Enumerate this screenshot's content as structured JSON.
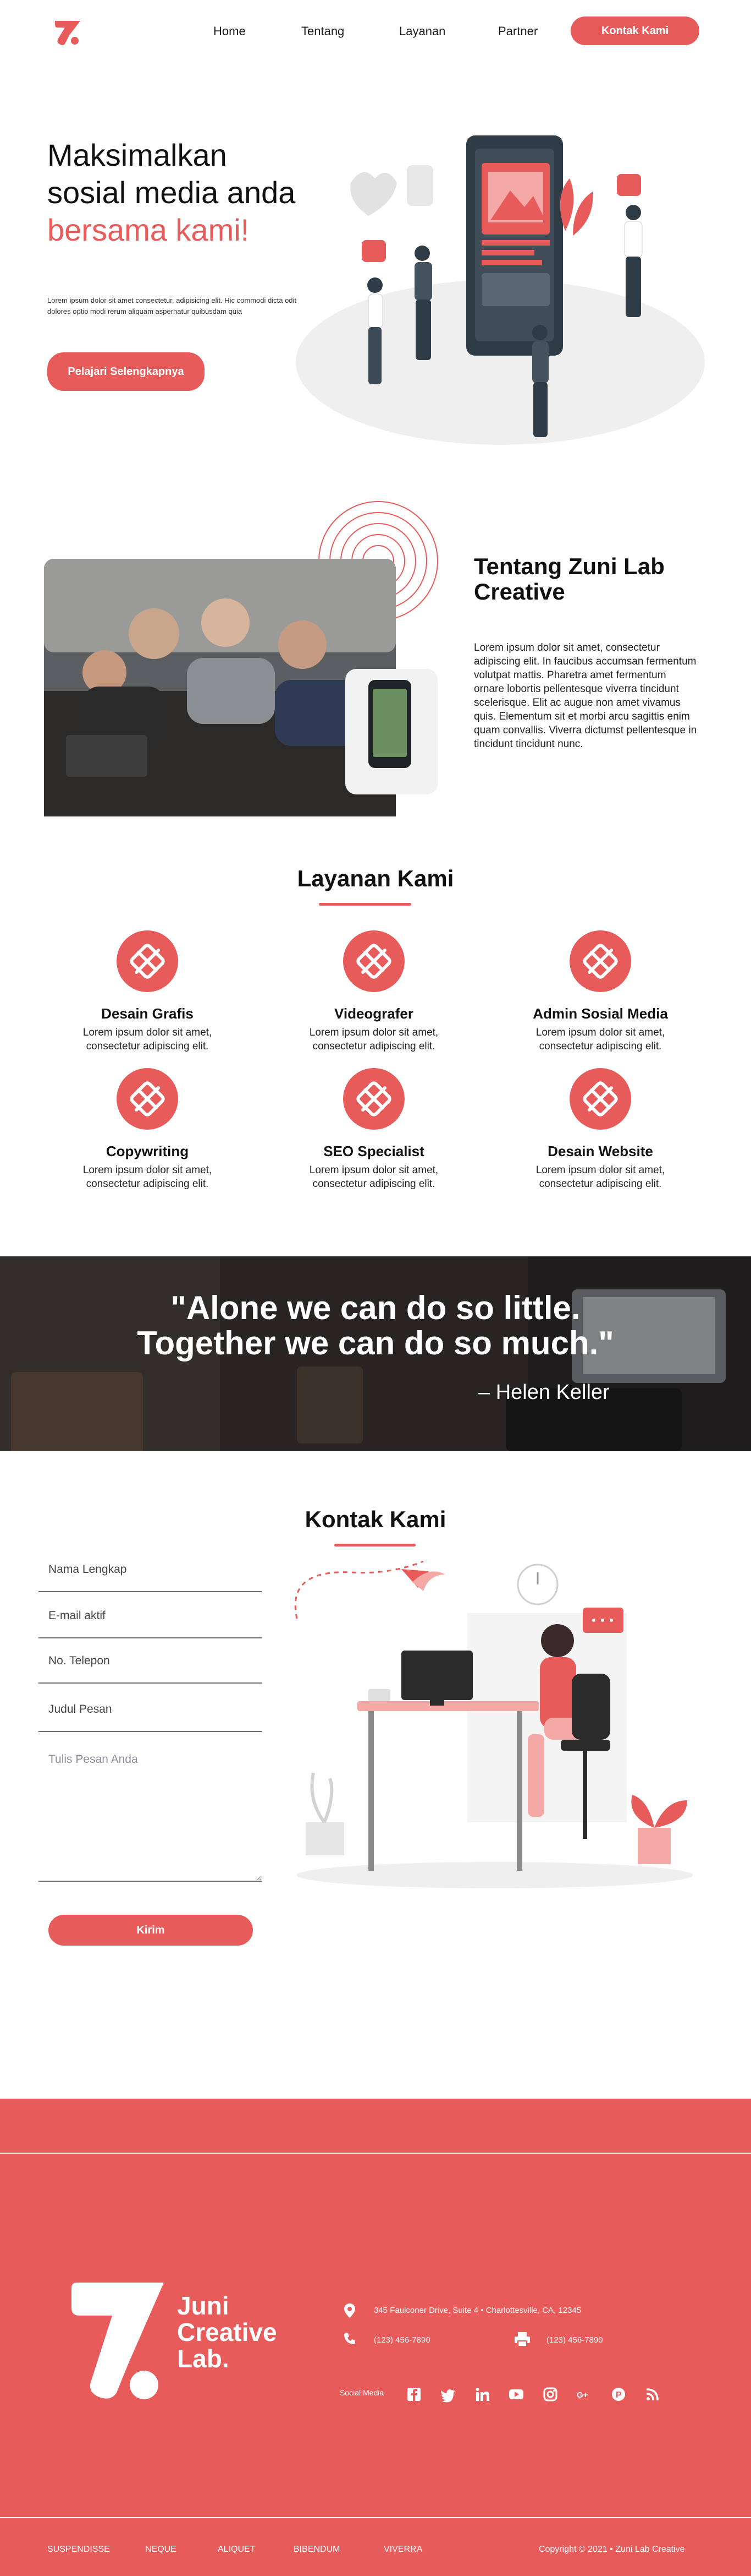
{
  "nav": {
    "links": [
      "Home",
      "Tentang",
      "Layanan",
      "Partner"
    ],
    "cta": "Kontak Kami"
  },
  "hero": {
    "title_part1": "Maksimalkan sosial media anda",
    "title_highlight": "bersama kami!",
    "subtitle": "Lorem ipsum dolor sit amet consectetur, adipisicing elit. Hic commodi dicta odit dolores optio modi rerum aliquam aspernatur quibusdam quia",
    "button": "Pelajari Selengkapnya"
  },
  "about": {
    "title": "Tentang Zuni Lab Creative",
    "text": "Lorem ipsum dolor sit amet, consectetur adipiscing elit. In faucibus accumsan fermentum volutpat mattis. Pharetra amet fermentum ornare lobortis pellentesque viverra tincidunt scelerisque. Elit ac augue non amet vivamus quis. Elementum sit et morbi arcu sagittis enim quam convallis. Viverra dictumst pellentesque in tincidunt tincidunt nunc."
  },
  "services": {
    "title": "Layanan Kami",
    "items": [
      {
        "name": "Desain Grafis",
        "desc": "Lorem ipsum dolor sit amet, consectetur adipiscing elit.",
        "icon": "design-tools-icon"
      },
      {
        "name": "Videografer",
        "desc": "Lorem ipsum dolor sit amet, consectetur adipiscing elit.",
        "icon": "design-tools-icon"
      },
      {
        "name": "Admin Sosial Media",
        "desc": "Lorem ipsum dolor sit amet, consectetur adipiscing elit.",
        "icon": "design-tools-icon"
      },
      {
        "name": "Copywriting",
        "desc": "Lorem ipsum dolor sit amet, consectetur adipiscing elit.",
        "icon": "design-tools-icon"
      },
      {
        "name": "SEO Specialist",
        "desc": "Lorem ipsum dolor sit amet, consectetur adipiscing elit.",
        "icon": "design-tools-icon"
      },
      {
        "name": "Desain Website",
        "desc": "Lorem ipsum dolor sit amet, consectetur adipiscing elit.",
        "icon": "design-tools-icon"
      }
    ]
  },
  "quote": {
    "line1": "\"Alone we can do so little.",
    "line2": "Together we can do so much.\"",
    "author": "– Helen Keller"
  },
  "contact": {
    "title": "Kontak Kami",
    "placeholders": {
      "name": "Nama Lengkap",
      "email": "E-mail aktif",
      "phone": "No. Telepon",
      "subject": "Judul Pesan",
      "message": "Tulis Pesan Anda"
    },
    "button": "Kirim"
  },
  "footer": {
    "brand": "Juni Creative Lab.",
    "address": "345 Faulconer Drive, Suite 4 • Charlottesville, CA, 12345",
    "phone": "(123) 456-7890",
    "fax": "(123) 456-7890",
    "social_label": "Social Media",
    "social_icons": [
      "facebook-icon",
      "twitter-icon",
      "linkedin-icon",
      "youtube-icon",
      "instagram-icon",
      "google-plus-icon",
      "pinterest-icon",
      "rss-icon"
    ],
    "menu": [
      "SUSPENDISSE",
      "NEQUE",
      "ALIQUET",
      "BIBENDUM",
      "VIVERRA"
    ],
    "copyright": "Copyright © 2021 • Zuni Lab Creative"
  },
  "colors": {
    "accent": "#e85b5b",
    "dark": "#2f3b45"
  }
}
